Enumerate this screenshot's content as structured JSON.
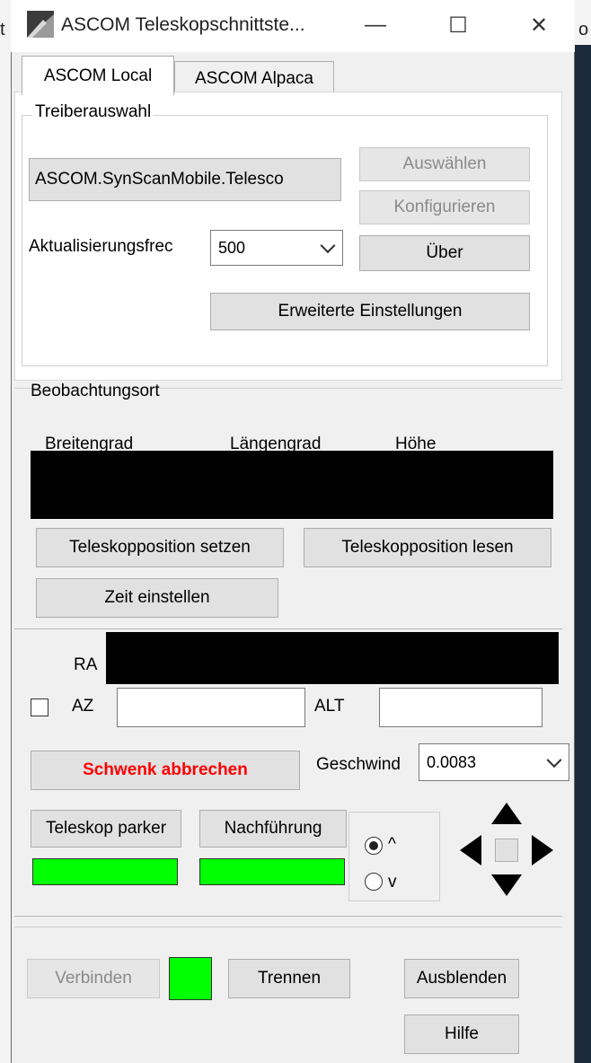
{
  "window": {
    "title": "ASCOM Teleskopschnittste...",
    "minimize_glyph": "—",
    "maximize_glyph": "☐",
    "close_glyph": "✕"
  },
  "background": {
    "left_char_top": "t",
    "right_char_top": "o"
  },
  "tabs": [
    {
      "label": "ASCOM Local",
      "active": true
    },
    {
      "label": "ASCOM Alpaca",
      "active": false
    }
  ],
  "driver_selection": {
    "group_label": "Treiberauswahl",
    "driver_name": "ASCOM.SynScanMobile.Telesco",
    "select_button": "Auswählen",
    "configure_button": "Konfigurieren",
    "about_button": "Über",
    "update_freq_label": "Aktualisierungsfrec",
    "update_freq_value": "500",
    "advanced_button": "Erweiterte Einstellungen"
  },
  "observation_site": {
    "group_label": "Beobachtungsort",
    "latitude_label": "Breitengrad",
    "longitude_label": "Längengrad",
    "altitude_label": "Höhe",
    "set_position_button": "Teleskopposition setzen",
    "read_position_button": "Teleskopposition lesen",
    "set_time_button": "Zeit einstellen"
  },
  "coordinates": {
    "ra_label": "RA",
    "az_label": "AZ",
    "alt_label": "ALT",
    "az_value": "",
    "alt_value": "",
    "az_checked": false
  },
  "slew": {
    "abort_button": "Schwenk abbrechen",
    "abort_color": "#ff0000",
    "speed_label": "Geschwind",
    "speed_value": "0.0083"
  },
  "controls": {
    "park_button": "Teleskop parker",
    "tracking_button": "Nachführung",
    "park_status_color": "#00ff00",
    "tracking_status_color": "#00ff00",
    "direction_up_label": "^",
    "direction_down_label": "v",
    "direction_selected": "up"
  },
  "footer": {
    "connect_button": "Verbinden",
    "connect_status_color": "#00ff00",
    "disconnect_button": "Trennen",
    "hide_button": "Ausblenden",
    "help_button": "Hilfe"
  }
}
